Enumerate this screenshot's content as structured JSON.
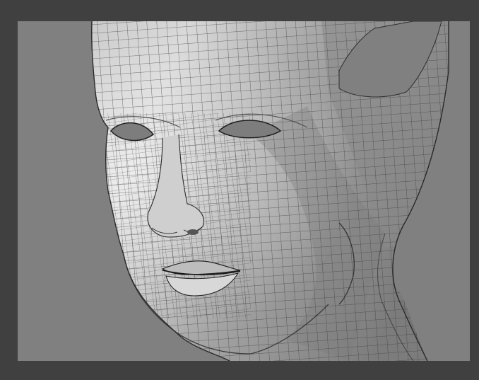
{
  "scene": {
    "subject": "head-mesh",
    "render_style": "wireframe-over-shaded",
    "colors": {
      "frame": "#404040",
      "background": "#808080",
      "mesh_light": "#d9d9d9",
      "mesh_mid": "#a8a8a8",
      "mesh_dark": "#6e6e6e",
      "wire": "#2e2e2e"
    }
  }
}
